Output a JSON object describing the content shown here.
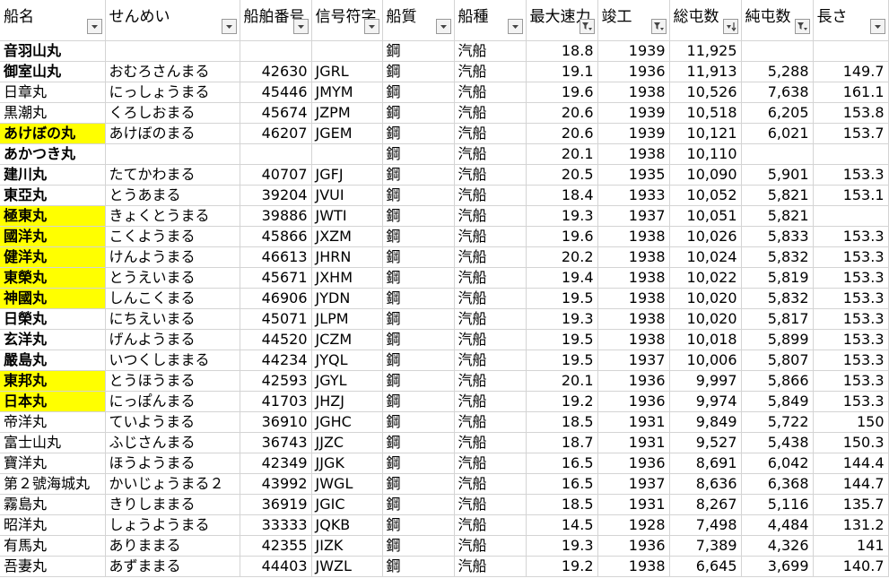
{
  "headers": [
    {
      "label": "船名",
      "filter": "dropdown"
    },
    {
      "label": "せんめい",
      "filter": "dropdown"
    },
    {
      "label": "船舶番号",
      "filter": "dropdown"
    },
    {
      "label": "信号符字",
      "filter": "dropdown"
    },
    {
      "label": "船質",
      "filter": "dropdown"
    },
    {
      "label": "船種",
      "filter": "dropdown"
    },
    {
      "label": "最大速力",
      "filter": "filtered"
    },
    {
      "label": "竣工",
      "filter": "filtered"
    },
    {
      "label": "総屯数",
      "filter": "sorted-desc"
    },
    {
      "label": "純屯数",
      "filter": "filtered"
    },
    {
      "label": "長さ",
      "filter": "dropdown"
    }
  ],
  "highlight_color": "#ffff00",
  "rows": [
    {
      "name": "音羽山丸",
      "bold": true,
      "hl": false,
      "kana": "",
      "no": "",
      "sig": "",
      "mat": "鋼",
      "type": "汽船",
      "speed": "18.8",
      "year": "1939",
      "gt": "11,925",
      "nt": "",
      "len": ""
    },
    {
      "name": "御室山丸",
      "bold": true,
      "hl": false,
      "kana": "おむろさんまる",
      "no": "42630",
      "sig": "JGRL",
      "mat": "鋼",
      "type": "汽船",
      "speed": "19.1",
      "year": "1936",
      "gt": "11,913",
      "nt": "5,288",
      "len": "149.7"
    },
    {
      "name": "日章丸",
      "bold": false,
      "hl": false,
      "kana": "にっしょうまる",
      "no": "45446",
      "sig": "JMYM",
      "mat": "鋼",
      "type": "汽船",
      "speed": "19.6",
      "year": "1938",
      "gt": "10,526",
      "nt": "7,638",
      "len": "161.1"
    },
    {
      "name": "黒潮丸",
      "bold": false,
      "hl": false,
      "kana": "くろしおまる",
      "no": "45674",
      "sig": "JZPM",
      "mat": "鋼",
      "type": "汽船",
      "speed": "20.6",
      "year": "1939",
      "gt": "10,518",
      "nt": "6,205",
      "len": "153.8"
    },
    {
      "name": "あけぼの丸",
      "bold": true,
      "hl": true,
      "kana": "あけぼのまる",
      "no": "46207",
      "sig": "JGEM",
      "mat": "鋼",
      "type": "汽船",
      "speed": "20.6",
      "year": "1939",
      "gt": "10,121",
      "nt": "6,021",
      "len": "153.7"
    },
    {
      "name": "あかつき丸",
      "bold": true,
      "hl": false,
      "kana": "",
      "no": "",
      "sig": "",
      "mat": "鋼",
      "type": "汽船",
      "speed": "20.1",
      "year": "1938",
      "gt": "10,110",
      "nt": "",
      "len": ""
    },
    {
      "name": "建川丸",
      "bold": true,
      "hl": false,
      "kana": "たてかわまる",
      "no": "40707",
      "sig": "JGFJ",
      "mat": "鋼",
      "type": "汽船",
      "speed": "20.5",
      "year": "1935",
      "gt": "10,090",
      "nt": "5,901",
      "len": "153.3"
    },
    {
      "name": "東亞丸",
      "bold": true,
      "hl": false,
      "kana": "とうあまる",
      "no": "39204",
      "sig": "JVUI",
      "mat": "鋼",
      "type": "汽船",
      "speed": "18.4",
      "year": "1933",
      "gt": "10,052",
      "nt": "5,821",
      "len": "153.1"
    },
    {
      "name": "極東丸",
      "bold": true,
      "hl": true,
      "kana": "きょくとうまる",
      "no": "39886",
      "sig": "JWTI",
      "mat": "鋼",
      "type": "汽船",
      "speed": "19.3",
      "year": "1937",
      "gt": "10,051",
      "nt": "5,821",
      "len": ""
    },
    {
      "name": "國洋丸",
      "bold": true,
      "hl": true,
      "kana": "こくようまる",
      "no": "45866",
      "sig": "JXZM",
      "mat": "鋼",
      "type": "汽船",
      "speed": "19.6",
      "year": "1938",
      "gt": "10,026",
      "nt": "5,833",
      "len": "153.3"
    },
    {
      "name": "健洋丸",
      "bold": true,
      "hl": true,
      "kana": "けんようまる",
      "no": "46613",
      "sig": "JHRN",
      "mat": "鋼",
      "type": "汽船",
      "speed": "20.2",
      "year": "1938",
      "gt": "10,024",
      "nt": "5,832",
      "len": "153.3"
    },
    {
      "name": "東榮丸",
      "bold": true,
      "hl": true,
      "kana": "とうえいまる",
      "no": "45671",
      "sig": "JXHM",
      "mat": "鋼",
      "type": "汽船",
      "speed": "19.4",
      "year": "1938",
      "gt": "10,022",
      "nt": "5,819",
      "len": "153.3"
    },
    {
      "name": "神國丸",
      "bold": true,
      "hl": true,
      "kana": "しんこくまる",
      "no": "46906",
      "sig": "JYDN",
      "mat": "鋼",
      "type": "汽船",
      "speed": "19.5",
      "year": "1938",
      "gt": "10,020",
      "nt": "5,832",
      "len": "153.3"
    },
    {
      "name": "日榮丸",
      "bold": true,
      "hl": false,
      "kana": "にちえいまる",
      "no": "45071",
      "sig": "JLPM",
      "mat": "鋼",
      "type": "汽船",
      "speed": "19.3",
      "year": "1938",
      "gt": "10,020",
      "nt": "5,817",
      "len": "153.3"
    },
    {
      "name": "玄洋丸",
      "bold": true,
      "hl": false,
      "kana": "げんようまる",
      "no": "44520",
      "sig": "JCZM",
      "mat": "鋼",
      "type": "汽船",
      "speed": "19.5",
      "year": "1938",
      "gt": "10,018",
      "nt": "5,899",
      "len": "153.3"
    },
    {
      "name": "嚴島丸",
      "bold": true,
      "hl": false,
      "kana": "いつくしままる",
      "no": "44234",
      "sig": "JYQL",
      "mat": "鋼",
      "type": "汽船",
      "speed": "19.5",
      "year": "1937",
      "gt": "10,006",
      "nt": "5,807",
      "len": "153.3"
    },
    {
      "name": "東邦丸",
      "bold": true,
      "hl": true,
      "kana": "とうほうまる",
      "no": "42593",
      "sig": "JGYL",
      "mat": "鋼",
      "type": "汽船",
      "speed": "20.1",
      "year": "1936",
      "gt": "9,997",
      "nt": "5,866",
      "len": "153.3"
    },
    {
      "name": "日本丸",
      "bold": true,
      "hl": true,
      "kana": "にっぽんまる",
      "no": "41703",
      "sig": "JHZJ",
      "mat": "鋼",
      "type": "汽船",
      "speed": "19.2",
      "year": "1936",
      "gt": "9,974",
      "nt": "5,849",
      "len": "153.3"
    },
    {
      "name": "帝洋丸",
      "bold": false,
      "hl": false,
      "kana": "ていようまる",
      "no": "36910",
      "sig": "JGHC",
      "mat": "鋼",
      "type": "汽船",
      "speed": "18.5",
      "year": "1931",
      "gt": "9,849",
      "nt": "5,722",
      "len": "150"
    },
    {
      "name": "富士山丸",
      "bold": false,
      "hl": false,
      "kana": "ふじさんまる",
      "no": "36743",
      "sig": "JJZC",
      "mat": "鋼",
      "type": "汽船",
      "speed": "18.7",
      "year": "1931",
      "gt": "9,527",
      "nt": "5,438",
      "len": "150.3"
    },
    {
      "name": "寶洋丸",
      "bold": false,
      "hl": false,
      "kana": "ほうようまる",
      "no": "42349",
      "sig": "JJGK",
      "mat": "鋼",
      "type": "汽船",
      "speed": "16.5",
      "year": "1936",
      "gt": "8,691",
      "nt": "6,042",
      "len": "144.4"
    },
    {
      "name": "第２號海城丸",
      "bold": false,
      "hl": false,
      "kana": "かいじょうまる２",
      "no": "43992",
      "sig": "JWGL",
      "mat": "鋼",
      "type": "汽船",
      "speed": "16.5",
      "year": "1937",
      "gt": "8,636",
      "nt": "6,368",
      "len": "144.7"
    },
    {
      "name": "霧島丸",
      "bold": false,
      "hl": false,
      "kana": "きりしままる",
      "no": "36919",
      "sig": "JGIC",
      "mat": "鋼",
      "type": "汽船",
      "speed": "18.5",
      "year": "1931",
      "gt": "8,267",
      "nt": "5,116",
      "len": "135.7"
    },
    {
      "name": "昭洋丸",
      "bold": false,
      "hl": false,
      "kana": "しょうようまる",
      "no": "33333",
      "sig": "JQKB",
      "mat": "鋼",
      "type": "汽船",
      "speed": "14.5",
      "year": "1928",
      "gt": "7,498",
      "nt": "4,484",
      "len": "131.2"
    },
    {
      "name": "有馬丸",
      "bold": false,
      "hl": false,
      "kana": "ありままる",
      "no": "42355",
      "sig": "JIZK",
      "mat": "鋼",
      "type": "汽船",
      "speed": "19.3",
      "year": "1936",
      "gt": "7,389",
      "nt": "4,326",
      "len": "141"
    },
    {
      "name": "吾妻丸",
      "bold": false,
      "hl": false,
      "kana": "あずままる",
      "no": "44403",
      "sig": "JWZL",
      "mat": "鋼",
      "type": "汽船",
      "speed": "19.2",
      "year": "1938",
      "gt": "6,645",
      "nt": "3,699",
      "len": "140.7"
    }
  ]
}
